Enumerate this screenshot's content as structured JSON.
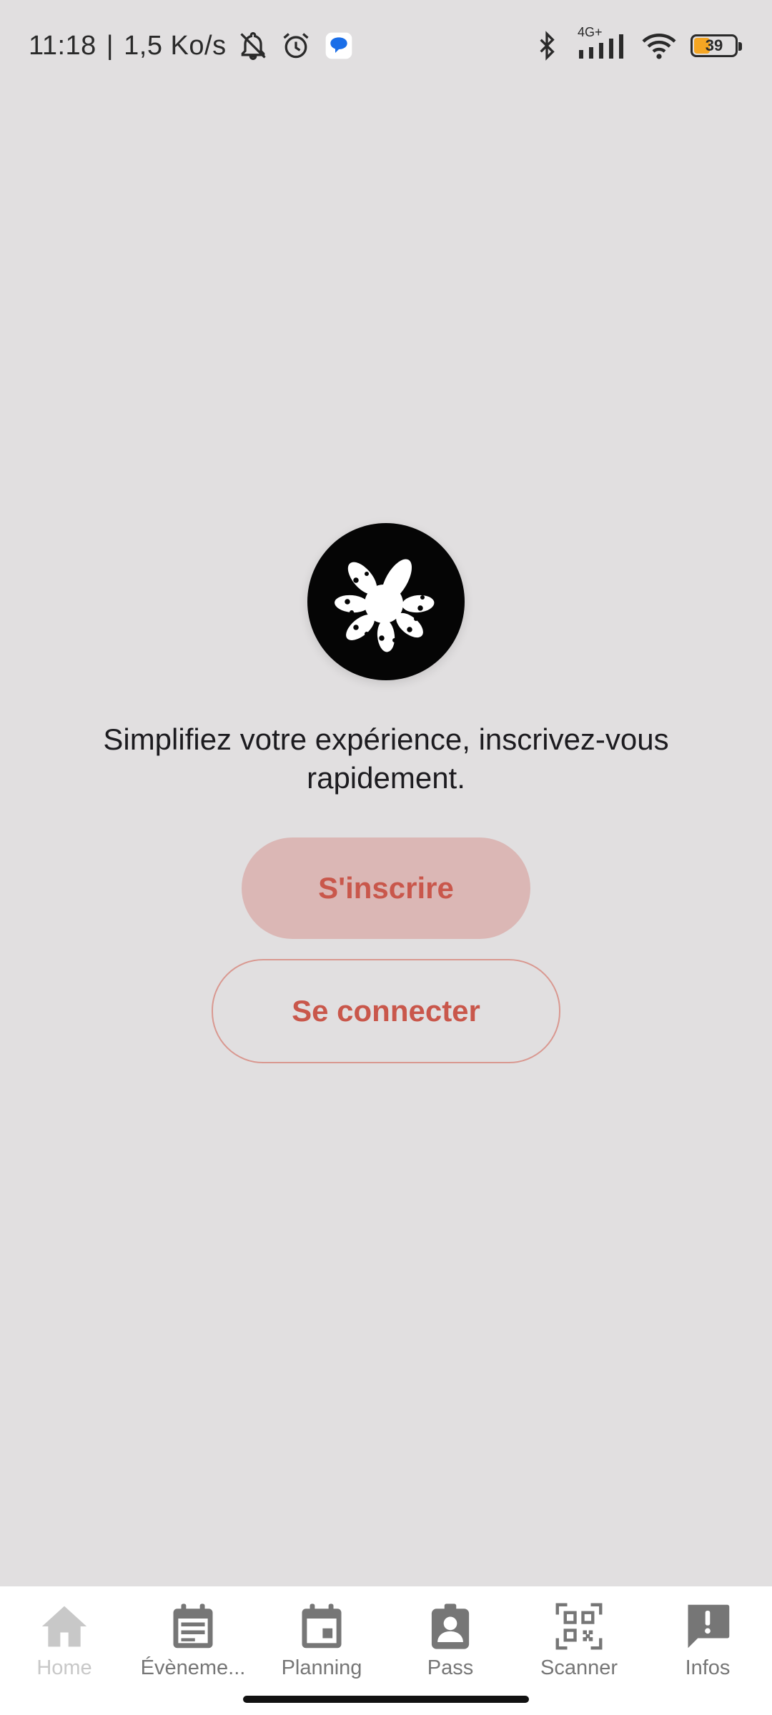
{
  "status_bar": {
    "time": "11:18",
    "separator": "|",
    "speed": "1,5 Ko/s",
    "network_type": "4G+",
    "battery_level": "39",
    "battery_fraction": 0.39,
    "battery_color": "#f5a623"
  },
  "main": {
    "tagline": "Simplifiez votre expérience, inscrivez-vous rapidement.",
    "signup_label": "S'inscrire",
    "login_label": "Se connecter"
  },
  "bottom_nav": {
    "items": [
      {
        "label": "Home",
        "icon": "home-icon",
        "active": true
      },
      {
        "label": "Évèneme...",
        "icon": "events-icon"
      },
      {
        "label": "Planning",
        "icon": "calendar-icon"
      },
      {
        "label": "Pass",
        "icon": "pass-icon"
      },
      {
        "label": "Scanner",
        "icon": "qr-code-icon"
      },
      {
        "label": "Infos",
        "icon": "info-alert-icon"
      }
    ]
  },
  "colors": {
    "accent": "#c9574b",
    "primary_button_bg": "#dbb7b5",
    "outline": "#d99890",
    "background": "#e1dfe0"
  }
}
